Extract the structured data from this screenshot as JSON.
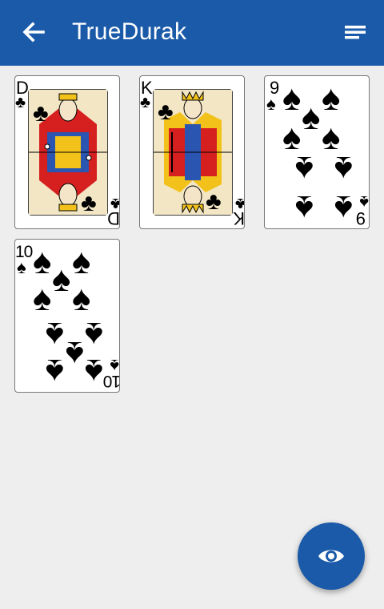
{
  "app": {
    "title": "TrueDurak"
  },
  "icons": {
    "back": "arrow-left-icon",
    "menu": "sort-lines-icon",
    "fab": "eye-icon"
  },
  "colors": {
    "primary": "#1a5aa8",
    "background": "#eeeeee",
    "icon": "#ffffff"
  },
  "cards": [
    {
      "rank": "D",
      "suit": "clubs",
      "suit_glyph": "♣"
    },
    {
      "rank": "K",
      "suit": "clubs",
      "suit_glyph": "♣"
    },
    {
      "rank": "9",
      "suit": "spades",
      "suit_glyph": "♠"
    },
    {
      "rank": "10",
      "suit": "spades",
      "suit_glyph": "♠"
    }
  ]
}
